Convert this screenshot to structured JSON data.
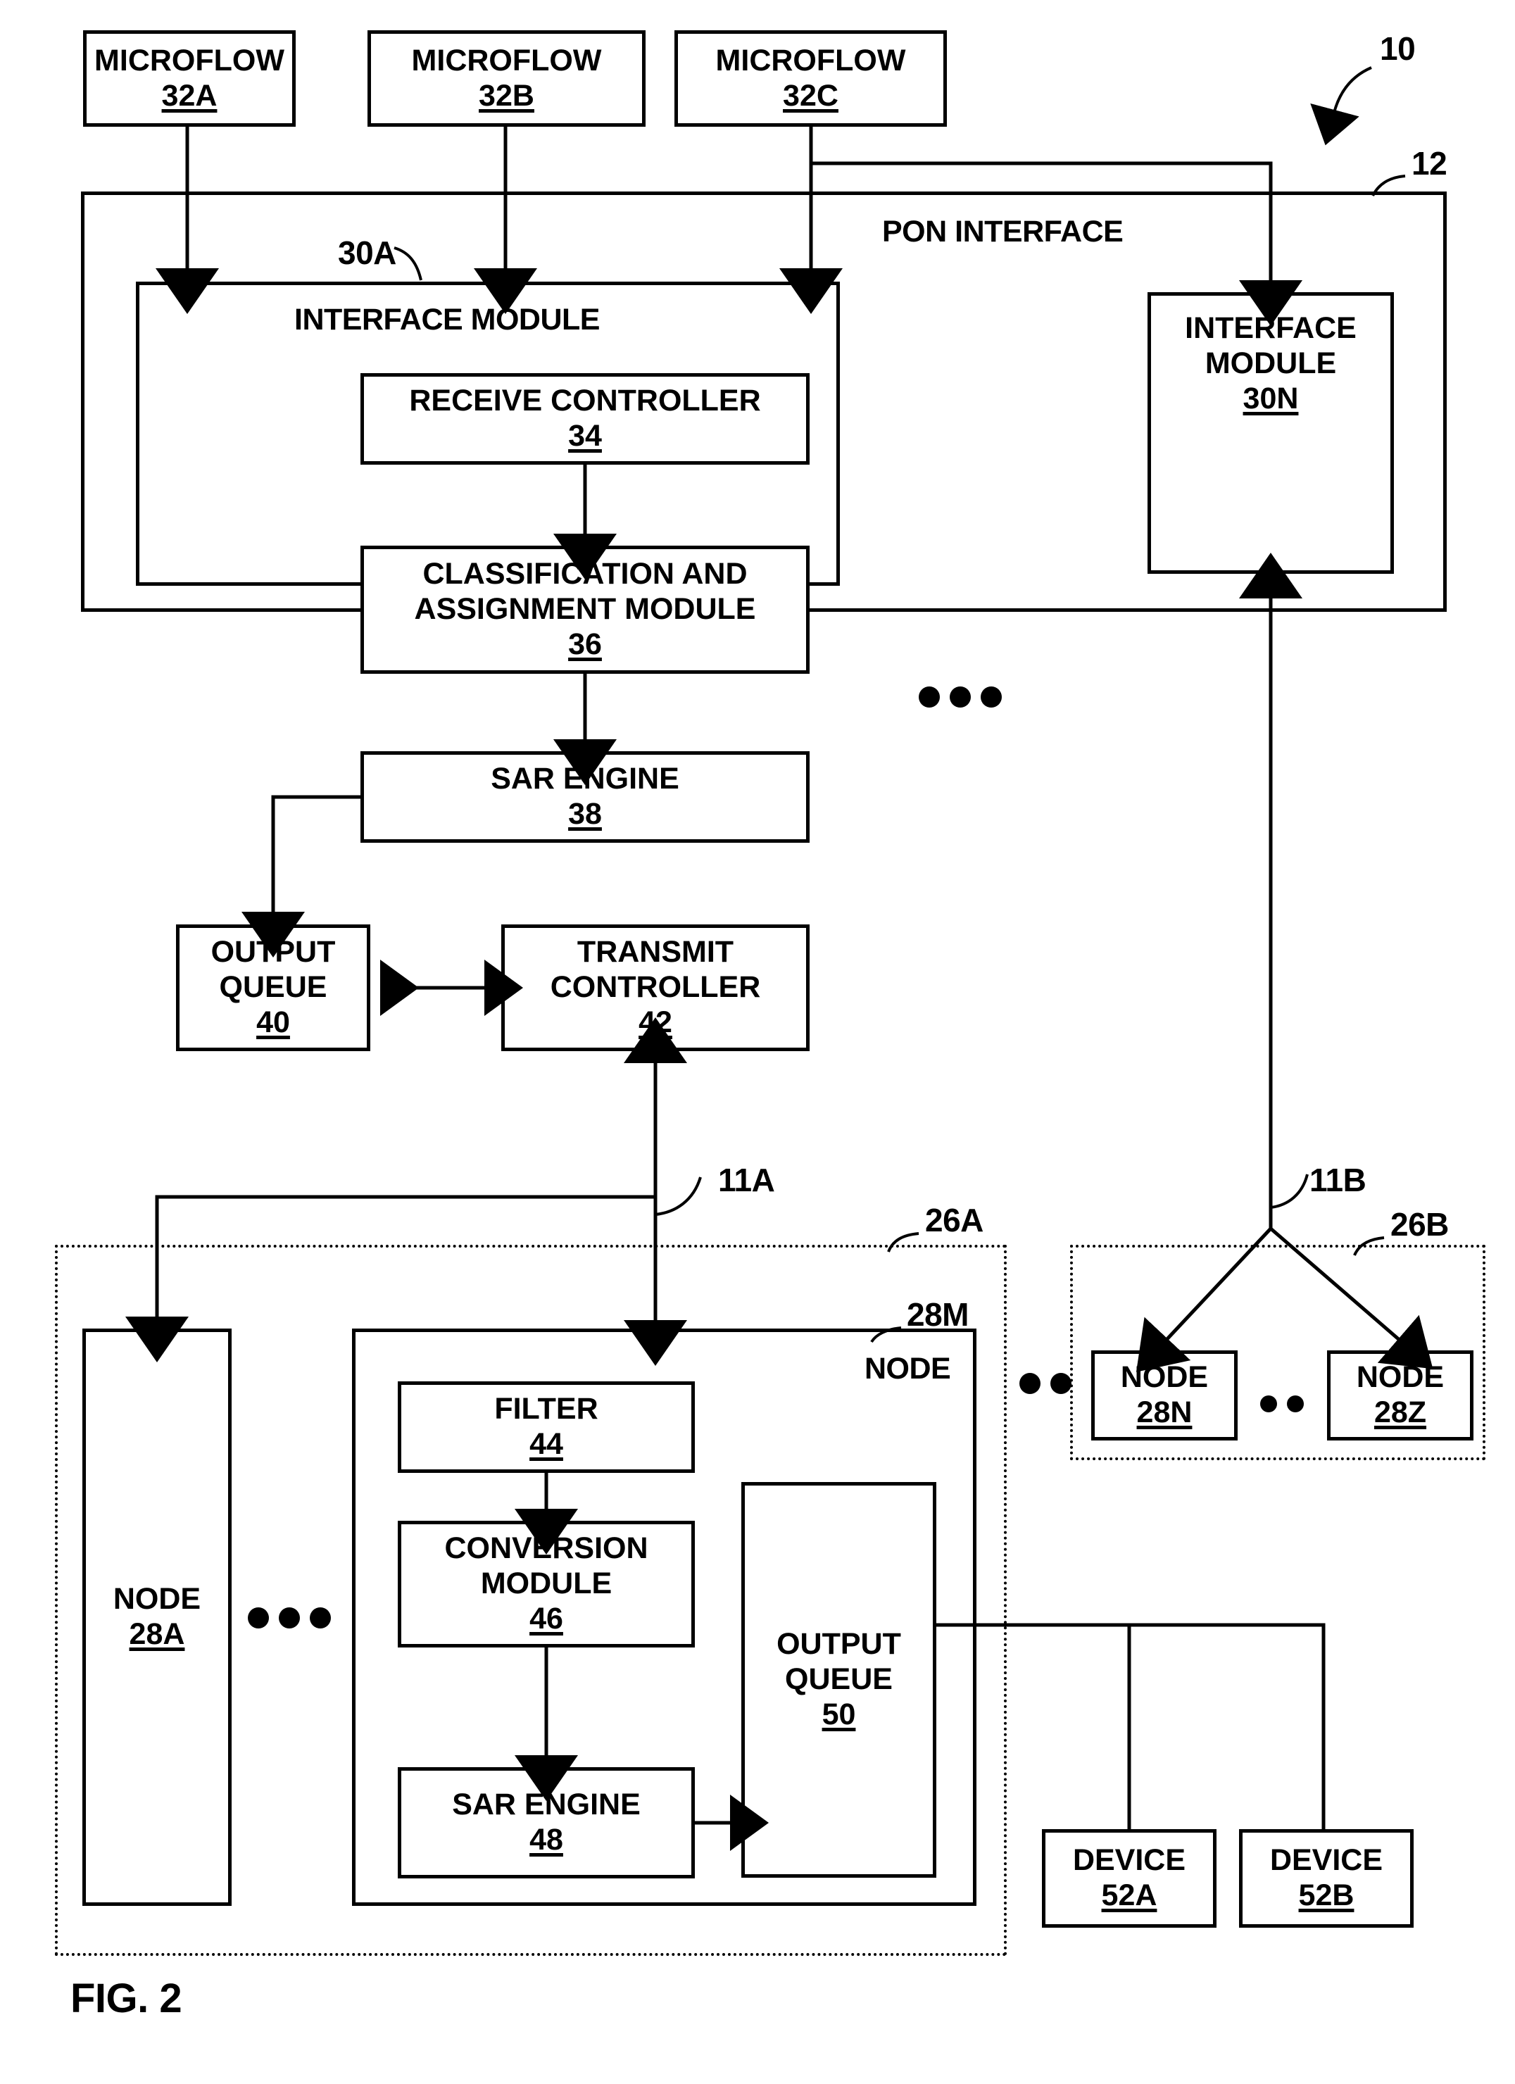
{
  "figure": {
    "label": "FIG. 2",
    "system_ref": "10",
    "pon_interface_ref": "12",
    "link_refs": {
      "left": "11A",
      "right": "11B"
    },
    "interface_module_a_ref": "30A"
  },
  "microflows": [
    {
      "title": "MICROFLOW",
      "ref": "32A"
    },
    {
      "title": "MICROFLOW",
      "ref": "32B"
    },
    {
      "title": "MICROFLOW",
      "ref": "32C"
    }
  ],
  "pon_interface": {
    "title": "PON INTERFACE",
    "interface_module_a": {
      "title": "INTERFACE MODULE",
      "ref": "30A",
      "blocks": [
        {
          "title": "RECEIVE CONTROLLER",
          "ref": "34"
        },
        {
          "title": "CLASSIFICATION AND ASSIGNMENT MODULE",
          "ref": "36"
        },
        {
          "title": "SAR ENGINE",
          "ref": "38"
        },
        {
          "title": "OUTPUT QUEUE",
          "ref": "40"
        },
        {
          "title": "TRANSMIT CONTROLLER",
          "ref": "42"
        }
      ]
    },
    "interface_module_n": {
      "title": "INTERFACE MODULE",
      "ref": "30N"
    },
    "ellipsis": "•••"
  },
  "node_group_a": {
    "ref": "26A",
    "node_first": {
      "title": "NODE",
      "ref": "28A"
    },
    "ellipsis": "•••",
    "node_detail": {
      "title": "NODE",
      "ref": "28M",
      "blocks": [
        {
          "title": "FILTER",
          "ref": "44"
        },
        {
          "title": "CONVERSION MODULE",
          "ref": "46"
        },
        {
          "title": "SAR ENGINE",
          "ref": "48"
        },
        {
          "title": "OUTPUT QUEUE",
          "ref": "50"
        }
      ]
    }
  },
  "node_group_b": {
    "ref": "26B",
    "nodes": [
      {
        "title": "NODE",
        "ref": "28N"
      },
      {
        "title": "NODE",
        "ref": "28Z"
      }
    ],
    "ellipsis": "••"
  },
  "devices": [
    {
      "title": "DEVICE",
      "ref": "52A"
    },
    {
      "title": "DEVICE",
      "ref": "52B"
    }
  ],
  "ellipsis_outer": "••"
}
